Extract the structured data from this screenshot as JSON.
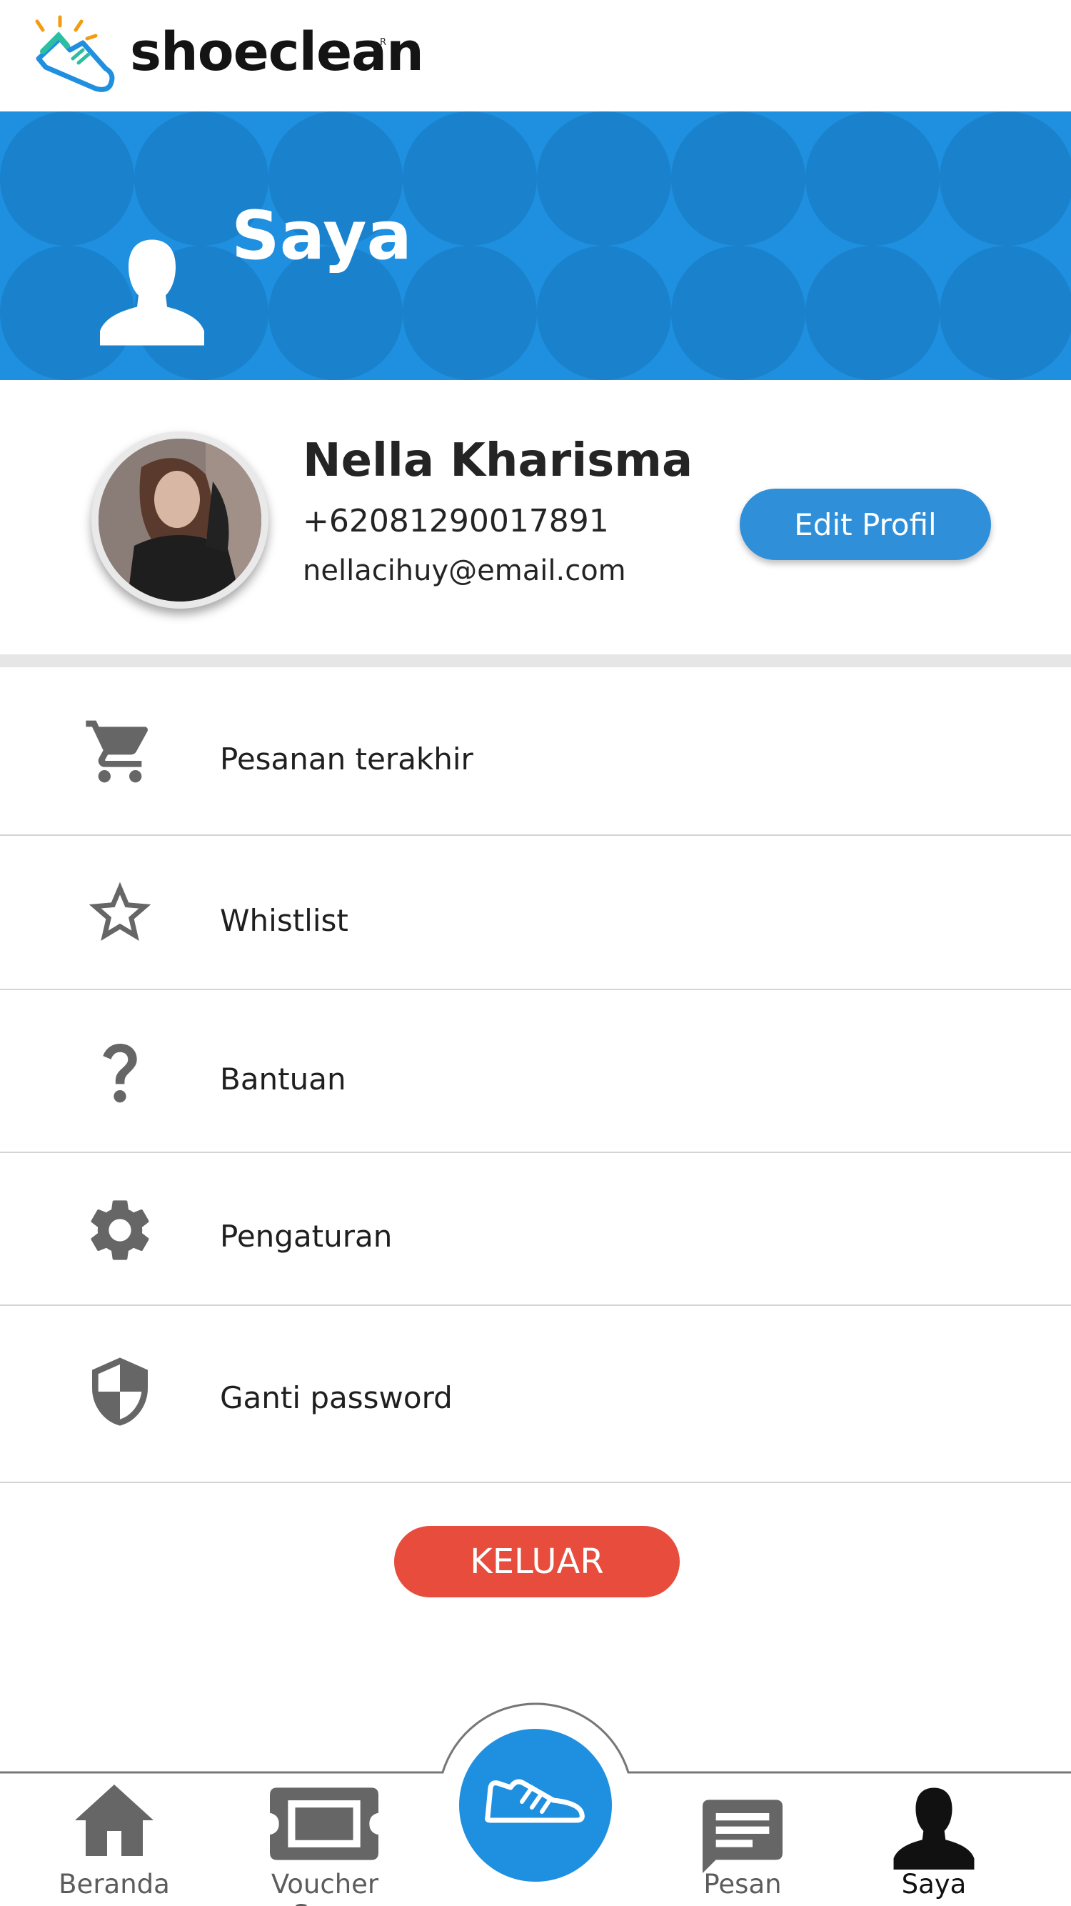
{
  "app": {
    "brand": "shoeclean",
    "brand_mark": "R"
  },
  "header": {
    "title": "Saya",
    "icon": "person-silhouette-icon"
  },
  "profile": {
    "name": "Nella Kharisma",
    "phone": "+62081290017891",
    "email": "nellacihuy@email.com",
    "edit_label": "Edit Profil"
  },
  "menu": [
    {
      "label": "Pesanan terakhir",
      "icon": "cart-icon"
    },
    {
      "label": "Whistlist",
      "icon": "star-icon"
    },
    {
      "label": "Bantuan",
      "icon": "help-icon"
    },
    {
      "label": "Pengaturan",
      "icon": "gear-icon"
    },
    {
      "label": "Ganti password",
      "icon": "shield-icon"
    }
  ],
  "logout_label": "KELUAR",
  "nav": [
    {
      "label": "Beranda",
      "icon": "home-icon",
      "active": false
    },
    {
      "label": "Voucher Saya",
      "icon": "ticket-icon",
      "active": false
    },
    {
      "label": "",
      "icon": "shoe-icon",
      "active": false
    },
    {
      "label": "Pesan",
      "icon": "message-icon",
      "active": false
    },
    {
      "label": "Saya",
      "icon": "person-icon",
      "active": true
    }
  ],
  "colors": {
    "primary": "#1f8fe0",
    "button_blue": "#2f8fd9",
    "logout_red": "#e74c3c",
    "icon_grey": "#666666"
  }
}
